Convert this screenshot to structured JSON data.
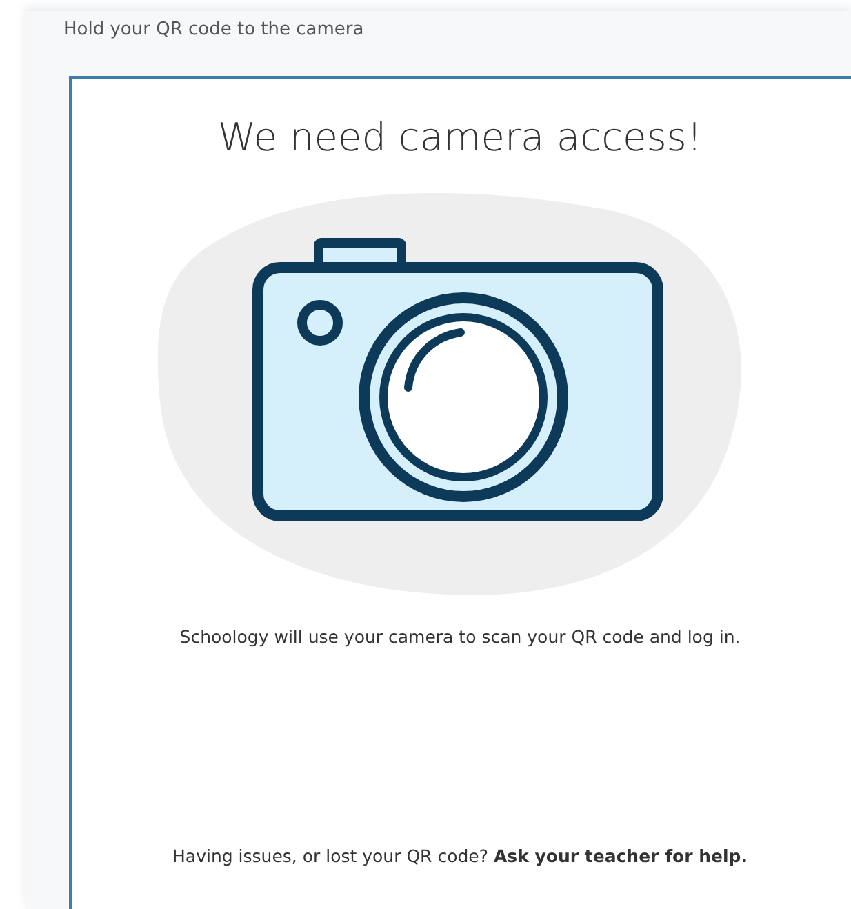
{
  "header": {
    "instruction": "Hold your QR code to the camera"
  },
  "card": {
    "title": "We need camera access!",
    "description": "Schoology will use your camera to scan your QR code and log in.",
    "help": "Having issues, or lost your QR code? **Ask your teacher for help.**"
  }
}
